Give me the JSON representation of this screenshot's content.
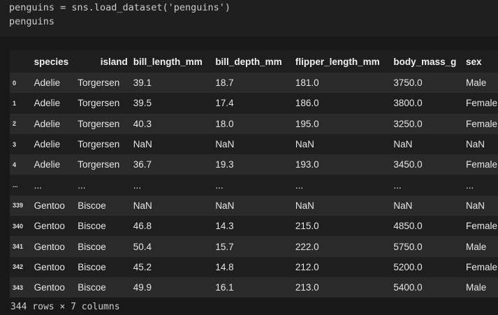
{
  "code": {
    "line1": "penguins = sns.load_dataset('penguins')",
    "line2": "penguins"
  },
  "table": {
    "columns": [
      "",
      "species",
      "island",
      "bill_length_mm",
      "bill_depth_mm",
      "flipper_length_mm",
      "body_mass_g",
      "sex"
    ],
    "rows": [
      [
        "0",
        "Adelie",
        "Torgersen",
        "39.1",
        "18.7",
        "181.0",
        "3750.0",
        "Male"
      ],
      [
        "1",
        "Adelie",
        "Torgersen",
        "39.5",
        "17.4",
        "186.0",
        "3800.0",
        "Female"
      ],
      [
        "2",
        "Adelie",
        "Torgersen",
        "40.3",
        "18.0",
        "195.0",
        "3250.0",
        "Female"
      ],
      [
        "3",
        "Adelie",
        "Torgersen",
        "NaN",
        "NaN",
        "NaN",
        "NaN",
        "NaN"
      ],
      [
        "4",
        "Adelie",
        "Torgersen",
        "36.7",
        "19.3",
        "193.0",
        "3450.0",
        "Female"
      ],
      [
        "...",
        "...",
        "...",
        "...",
        "...",
        "...",
        "...",
        "..."
      ],
      [
        "339",
        "Gentoo",
        "Biscoe",
        "NaN",
        "NaN",
        "NaN",
        "NaN",
        "NaN"
      ],
      [
        "340",
        "Gentoo",
        "Biscoe",
        "46.8",
        "14.3",
        "215.0",
        "4850.0",
        "Female"
      ],
      [
        "341",
        "Gentoo",
        "Biscoe",
        "50.4",
        "15.7",
        "222.0",
        "5750.0",
        "Male"
      ],
      [
        "342",
        "Gentoo",
        "Biscoe",
        "45.2",
        "14.8",
        "212.0",
        "5200.0",
        "Female"
      ],
      [
        "343",
        "Gentoo",
        "Biscoe",
        "49.9",
        "16.1",
        "213.0",
        "5400.0",
        "Male"
      ]
    ]
  },
  "footer": "344 rows × 7 columns"
}
